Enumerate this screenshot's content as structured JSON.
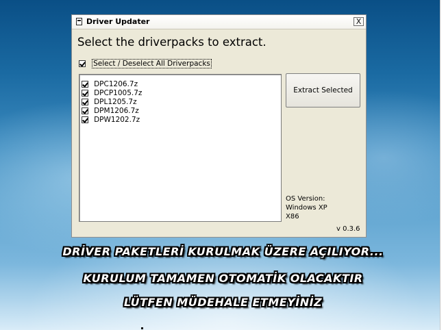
{
  "window": {
    "title": "Driver Updater",
    "close_label": "X",
    "heading": "Select the driverpacks to extract.",
    "select_all": {
      "label": "Select / Deselect All Driverpacks",
      "checked": true
    },
    "driverpacks": [
      {
        "label": "DPC1206.7z",
        "checked": true
      },
      {
        "label": "DPCP1005.7z",
        "checked": true
      },
      {
        "label": "DPL1205.7z",
        "checked": true
      },
      {
        "label": "DPM1206.7z",
        "checked": true
      },
      {
        "label": "DPW1202.7z",
        "checked": true
      }
    ],
    "extract_button": "Extract Selected",
    "os_info": {
      "line1": "OS Version:",
      "line2": "Windows XP",
      "line3": "X86"
    },
    "version": "v 0.3.6"
  },
  "overlay": {
    "line1": "DRİVER PAKETLERİ KURULMAK ÜZERE AÇILIYOR...",
    "line2": "KURULUM TAMAMEN OTOMATİK OLACAKTIR",
    "line3": "LÜTFEN MÜDEHALE ETMEYİNİZ"
  },
  "colors": {
    "window_bg": "#ece9d8",
    "desktop_top": "#0a4f86",
    "desktop_bottom": "#d9ecf8",
    "overlay_text": "#ffffff",
    "overlay_outline": "#000000"
  }
}
